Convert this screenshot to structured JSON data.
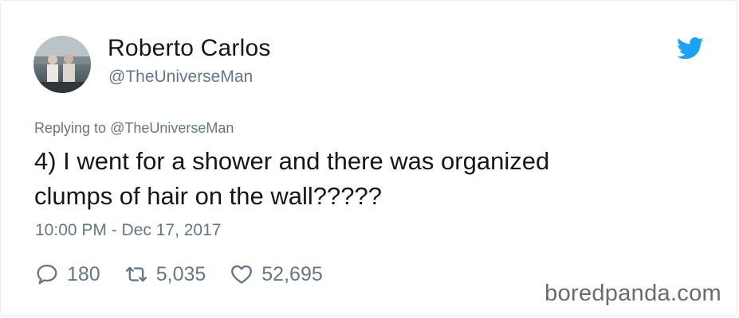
{
  "tweet": {
    "author": {
      "display_name": "Roberto Carlos",
      "handle": "@TheUniverseMan",
      "avatar_icon": "profile-photo"
    },
    "reply": {
      "prefix": "Replying to",
      "mention": "@TheUniverseMan"
    },
    "text_line1": "4) I went for a shower and there was organized",
    "text_line2": "clumps of hair on the wall?????",
    "timestamp": "10:00 PM - Dec 17, 2017",
    "stats": {
      "replies": "180",
      "retweets": "5,035",
      "likes": "52,695"
    },
    "brand_icon": "twitter-bird-icon",
    "brand_color": "#1da1f2",
    "muted_color": "#657786"
  },
  "watermark": {
    "text": "boredpanda.com"
  }
}
